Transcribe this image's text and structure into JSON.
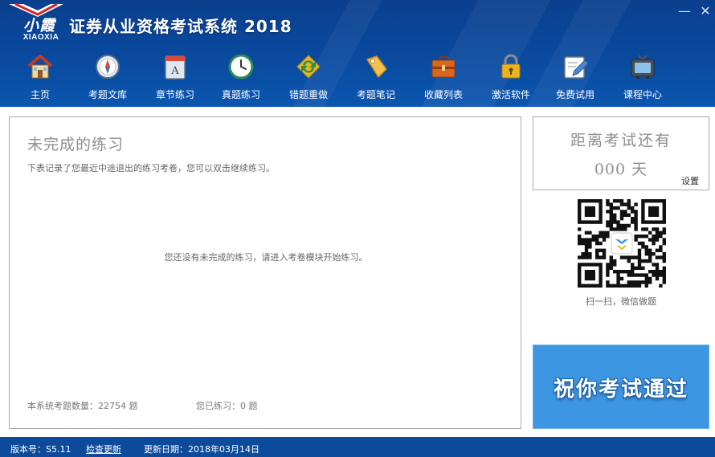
{
  "app": {
    "logo_cn": "小霞",
    "logo_en": "XIAOXIA",
    "title": "证券从业资格考试系统 2018",
    "minimize_symbol": "—",
    "close_symbol": "✕"
  },
  "toolbar": {
    "items": [
      {
        "label": "主页",
        "icon": "home-icon"
      },
      {
        "label": "考题文库",
        "icon": "compass-icon"
      },
      {
        "label": "章节练习",
        "icon": "book-icon"
      },
      {
        "label": "真题练习",
        "icon": "clock-icon"
      },
      {
        "label": "错题重做",
        "icon": "redo-icon"
      },
      {
        "label": "考题笔记",
        "icon": "tag-icon"
      },
      {
        "label": "收藏列表",
        "icon": "briefcase-icon"
      },
      {
        "label": "激活软件",
        "icon": "lock-icon"
      },
      {
        "label": "免费试用",
        "icon": "pencil-icon"
      },
      {
        "label": "课程中心",
        "icon": "tv-icon"
      }
    ]
  },
  "main": {
    "title": "未完成的练习",
    "subtitle": "下表记录了您最近中途退出的练习考卷，您可以双击继续练习。",
    "empty_message": "您还没有未完成的练习，请进入考卷模块开始练习。",
    "total_questions": "本系统考题数量：22754 题",
    "practiced": "您已练习：0 题"
  },
  "sidebar": {
    "countdown_title": "距离考试还有",
    "countdown_value": "000 天",
    "settings_label": "设置",
    "qr_caption": "扫一扫，微信做题",
    "blessing": "祝你考试通过"
  },
  "status": {
    "version": "版本号：S5.11",
    "check_update": "检查更新",
    "update_date": "更新日期：2018年03月14日"
  },
  "colors": {
    "header_bg": "#0b4a9f",
    "status_bg": "#0c4b9c",
    "blessing_bg": "#3d96e2",
    "muted_text": "#8e8e8e"
  }
}
